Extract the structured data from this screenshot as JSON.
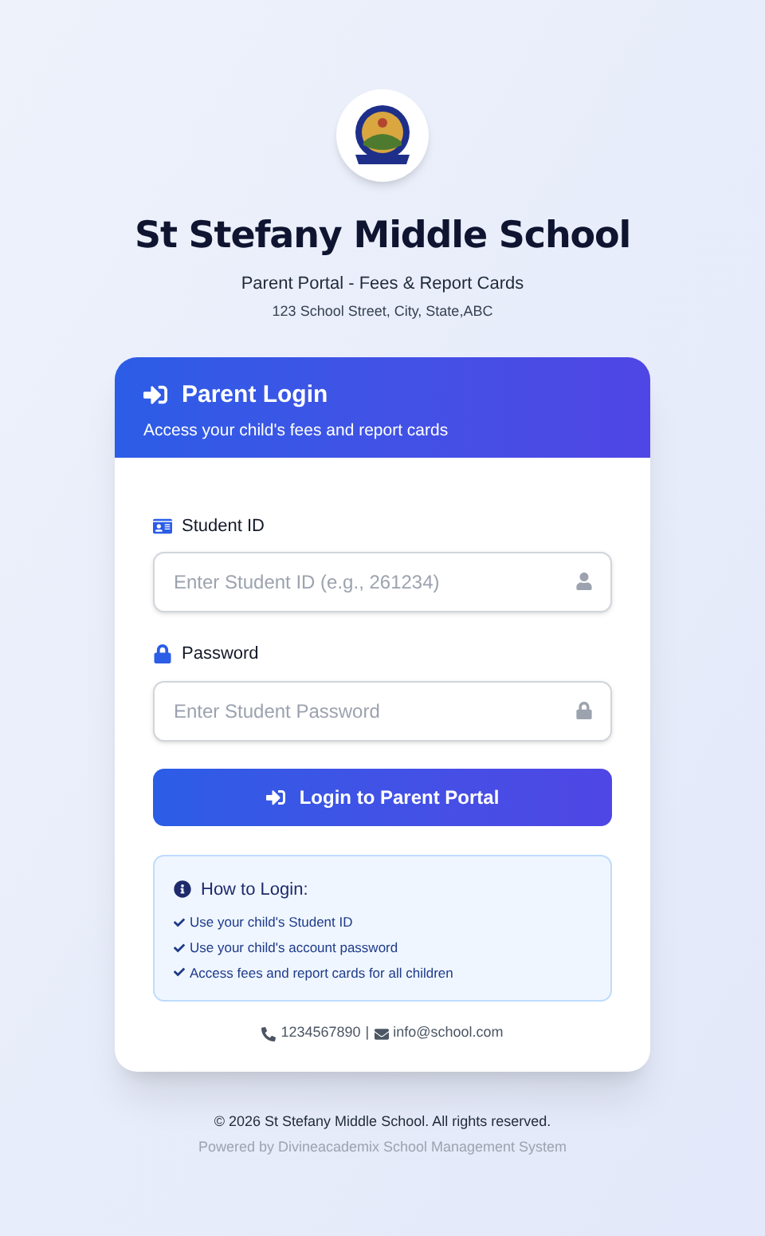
{
  "school": {
    "name": "St Stefany Middle School",
    "subtitle": "Parent Portal - Fees & Report Cards",
    "address": "123 School Street, City, State,ABC"
  },
  "login_card": {
    "title": "Parent Login",
    "subtitle": "Access your child's fees and report cards",
    "fields": [
      {
        "kind": "text",
        "label": "Student ID",
        "placeholder": "Enter Student ID (e.g., 261234)"
      },
      {
        "kind": "password",
        "label": "Password",
        "placeholder": "Enter Student Password"
      }
    ],
    "submit_button": "Login to Parent Portal",
    "help": {
      "title": "How to Login:",
      "items": [
        "Use your child's Student ID",
        "Use your child's account password",
        "Access fees and report cards for all children"
      ]
    },
    "contact": {
      "phone": "1234567890",
      "separator": "|",
      "email": "info@school.com"
    }
  },
  "footer": {
    "copyright": "© 2026 St Stefany Middle School. All rights reserved.",
    "powered_by": "Powered by Divineacademix School Management System"
  }
}
